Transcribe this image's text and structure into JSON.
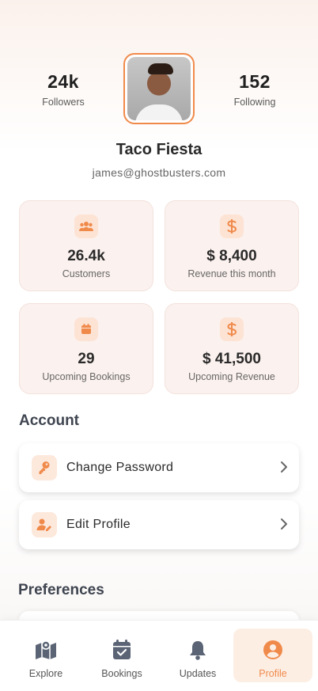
{
  "profile": {
    "followers_count": "24k",
    "followers_label": "Followers",
    "following_count": "152",
    "following_label": "Following",
    "name": "Taco Fiesta",
    "email": "james@ghostbusters.com"
  },
  "stats": [
    {
      "value": "26.4k",
      "label": "Customers",
      "icon": "users-icon"
    },
    {
      "value": "$ 8,400",
      "label": "Revenue this month",
      "icon": "dollar-icon"
    },
    {
      "value": "29",
      "label": "Upcoming Bookings",
      "icon": "calendar-icon"
    },
    {
      "value": "$ 41,500",
      "label": "Upcoming Revenue",
      "icon": "dollar-icon"
    }
  ],
  "account": {
    "title": "Account",
    "items": [
      {
        "label": "Change Password",
        "icon": "key-icon"
      },
      {
        "label": "Edit Profile",
        "icon": "user-edit-icon"
      }
    ]
  },
  "preferences": {
    "title": "Preferences"
  },
  "tabs": [
    {
      "label": "Explore",
      "icon": "map-icon"
    },
    {
      "label": "Bookings",
      "icon": "calendar-check-icon"
    },
    {
      "label": "Updates",
      "icon": "bell-icon"
    },
    {
      "label": "Profile",
      "icon": "user-circle-icon",
      "active": true
    }
  ],
  "colors": {
    "accent": "#f08a4b",
    "accent_soft": "#fde3d4",
    "card_bg": "#fbf1ee"
  }
}
